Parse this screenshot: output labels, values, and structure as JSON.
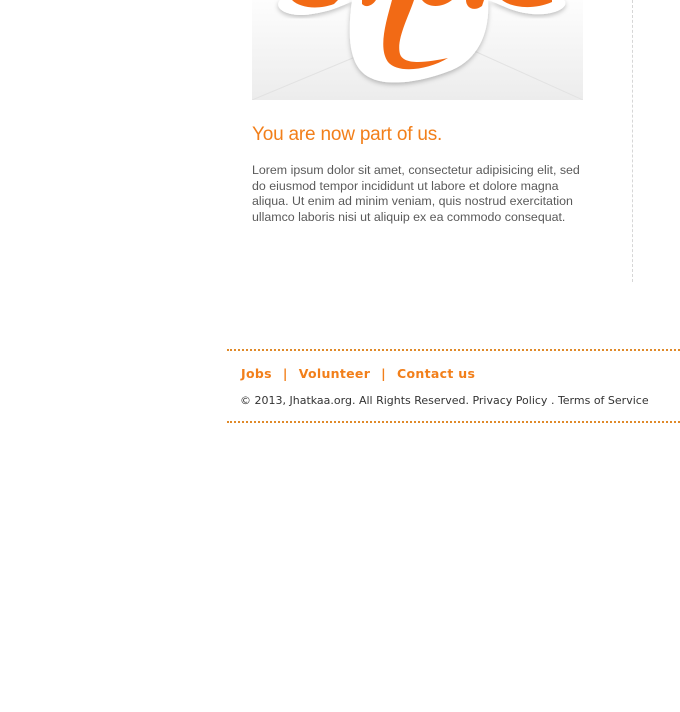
{
  "hero": {
    "logo_text": "Love"
  },
  "content": {
    "headline": "You are now part of us.",
    "body": "Lorem ipsum dolor sit amet, consectetur adipisicing elit, sed do eiusmod tempor incididunt ut labore et dolore magna aliqua. Ut enim ad minim veniam, quis nostrud exercitation ullamco laboris nisi ut aliquip ex ea commodo consequat."
  },
  "footer": {
    "links": {
      "jobs": "Jobs",
      "volunteer": "Volunteer",
      "contact": "Contact us",
      "separator": "|"
    },
    "copyright": "© 2013, Jhatkaa.org. All Rights Reserved.",
    "privacy": "Privacy Policy",
    "dot": ".",
    "terms": "Terms of Service"
  },
  "colors": {
    "accent": "#f27f1a",
    "body_text": "#5a5a5a",
    "rule": "#e08a2a"
  }
}
